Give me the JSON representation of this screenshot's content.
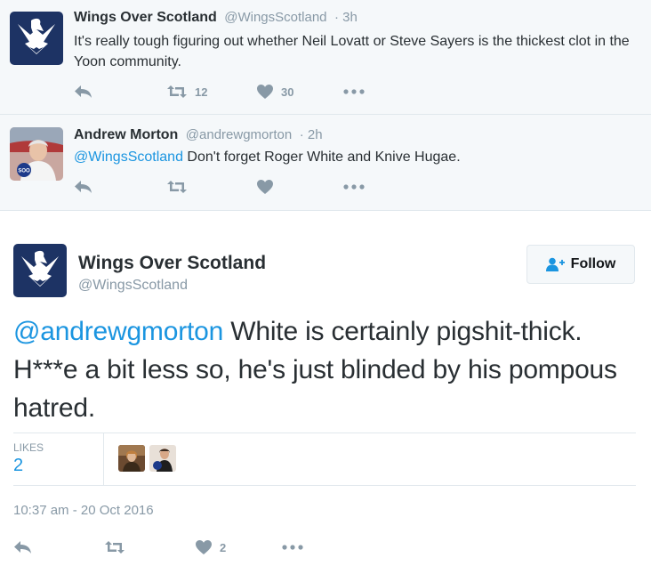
{
  "reply1": {
    "name": "Wings Over Scotland",
    "handle": "@WingsScotland",
    "time": "· 3h",
    "text": "It's really tough figuring out whether Neil Lovatt or Steve Sayers is the thickest clot in the Yoon community.",
    "retweets": "12",
    "likes": "30"
  },
  "reply2": {
    "name": "Andrew Morton",
    "handle": "@andrewgmorton",
    "time": "· 2h",
    "mention": "@WingsScotland",
    "text": " Don't forget Roger White and Knive Hugae."
  },
  "main": {
    "name": "Wings Over Scotland",
    "handle": "@WingsScotland",
    "follow_label": "Follow",
    "mention": "@andrewgmorton",
    "text": " White is certainly pigshit-thick. H***e a bit less so, he's just blinded by his pompous hatred.",
    "likes_label": "LIKES",
    "likes_count": "2",
    "timestamp": "10:37 am - 20 Oct 2016",
    "action_likes": "2"
  },
  "colors": {
    "link": "#1b95e0",
    "muted": "#8899a6",
    "avatar_bg": "#1d3364",
    "reply_bg": "#f5f8fa"
  },
  "icons": [
    "reply-icon",
    "retweet-icon",
    "heart-icon",
    "more-icon",
    "follow-person-icon",
    "wings-logo-icon"
  ],
  "avatar_badge": "SOO"
}
